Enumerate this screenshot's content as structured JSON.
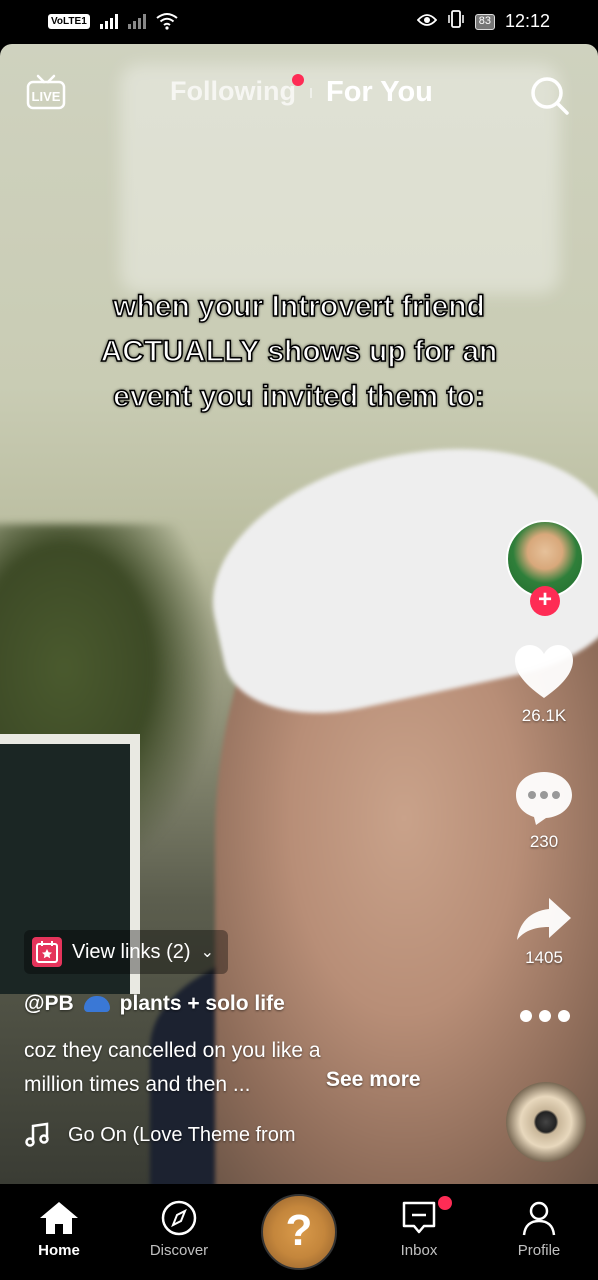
{
  "status_bar": {
    "network_badge": "VoLTE",
    "network_sub": "1",
    "battery": "83",
    "time": "12:12"
  },
  "top_nav": {
    "live_label": "LIVE",
    "tabs": [
      {
        "label": "Following",
        "has_notification_dot": true
      },
      {
        "label": "For You",
        "active": true
      }
    ],
    "icons": [
      "live-icon",
      "search-icon"
    ]
  },
  "video": {
    "overlay_text": [
      "when your Introvert friend",
      "ACTUALLY shows up for an",
      "event you invited them to:"
    ]
  },
  "right_rail": {
    "like_count": "26.1K",
    "comment_count": "230",
    "share_count": "1405",
    "follow_symbol": "+"
  },
  "post": {
    "links_label": "View links (2)",
    "links_chevron": "⌄",
    "author": "@PB",
    "author_tagline": "plants + solo life",
    "caption": [
      "coz they cancelled on you like a",
      "million times and then ..."
    ],
    "see_more": "See more",
    "music": "Go On (Love Theme from"
  },
  "bottom_nav": {
    "items": [
      {
        "label": "Home",
        "icon": "home-icon",
        "active": true
      },
      {
        "label": "Discover",
        "icon": "compass-icon"
      },
      {
        "label": "",
        "icon": "create-icon"
      },
      {
        "label": "Inbox",
        "icon": "inbox-icon",
        "has_notification_dot": true
      },
      {
        "label": "Profile",
        "icon": "profile-icon"
      }
    ],
    "create_glyph": "?"
  },
  "colors": {
    "accent": "#fe2c55",
    "background": "#000000"
  }
}
